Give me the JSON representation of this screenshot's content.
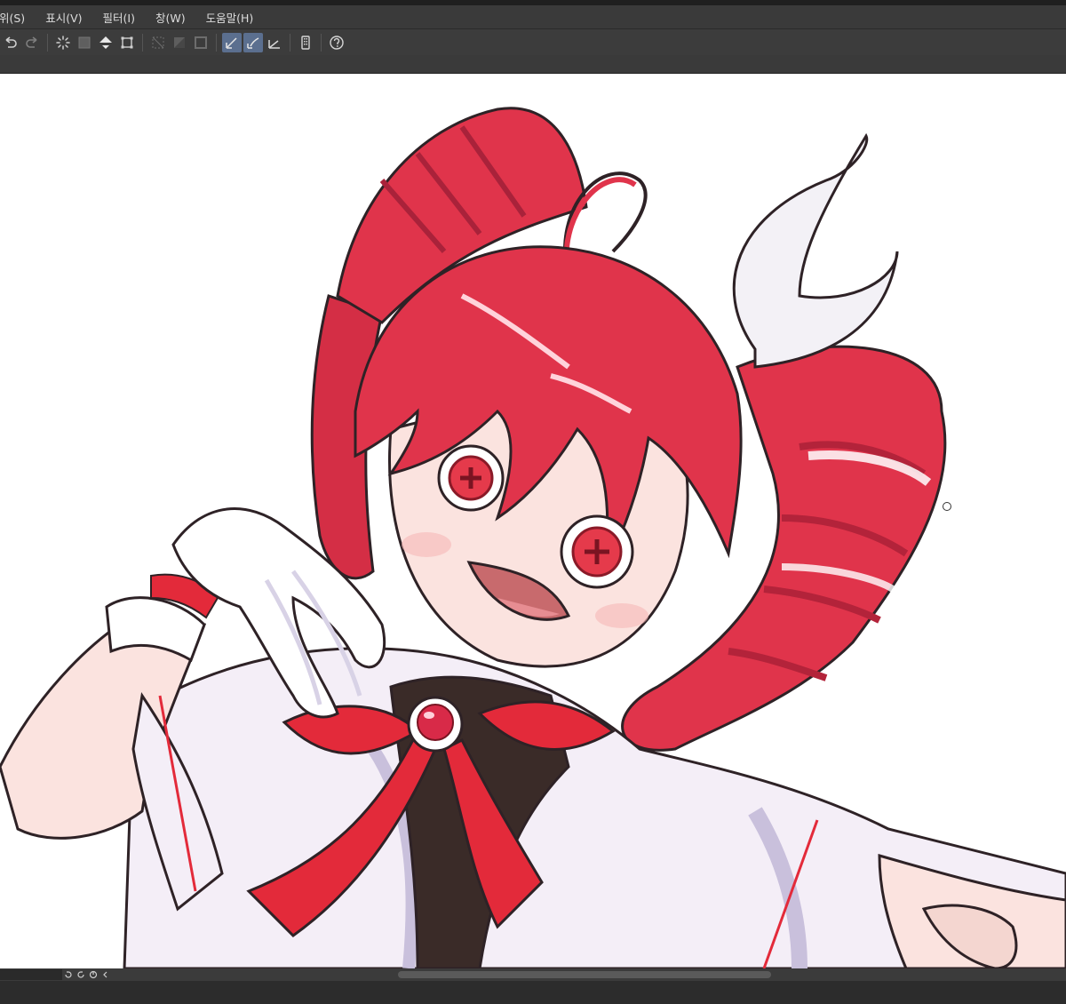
{
  "menubar": {
    "items": [
      {
        "label": "위(S)"
      },
      {
        "label": "표시(V)"
      },
      {
        "label": "필터(I)"
      },
      {
        "label": "창(W)"
      },
      {
        "label": "도움말(H)"
      }
    ]
  },
  "toolbar": {
    "buttons": [
      {
        "icon": "undo-icon"
      },
      {
        "icon": "redo-icon"
      },
      {
        "icon": "loading-spinner-icon"
      },
      {
        "icon": "selection-icon"
      },
      {
        "icon": "fill-bucket-icon"
      },
      {
        "icon": "transform-icon"
      },
      {
        "icon": "clear-selection-icon"
      },
      {
        "icon": "invert-selection-icon"
      },
      {
        "icon": "border-selection-icon"
      },
      {
        "icon": "ruler-snap-icon"
      },
      {
        "icon": "brush-snap-icon"
      },
      {
        "icon": "perspective-ruler-icon"
      },
      {
        "icon": "device-icon"
      },
      {
        "icon": "help-icon"
      }
    ]
  },
  "colors": {
    "hair": "#e0344b",
    "hair_shadow": "#b3233a",
    "eye": "#e53a4b",
    "bow": "#e32a3a",
    "skin": "#fbe3df",
    "shirt": "#f4eef7",
    "shirt_shadow": "#c9c0dc",
    "glove": "#ffffff",
    "outline": "#3a2a2e",
    "accent_toolbar": "#5b6f8f"
  }
}
